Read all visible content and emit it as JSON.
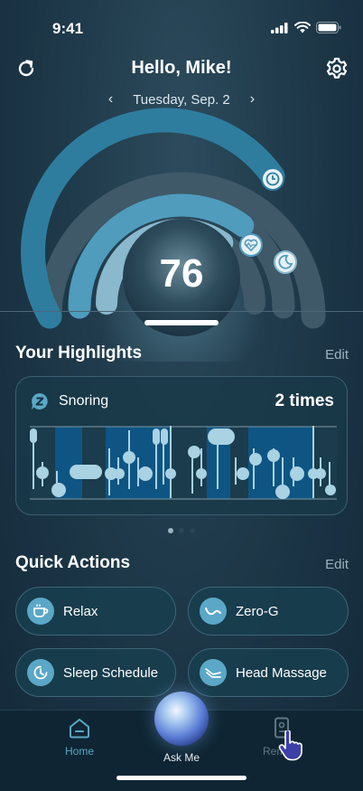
{
  "status": {
    "time": "9:41"
  },
  "header": {
    "greeting": "Hello, Mike!",
    "date": "Tuesday, Sep. 2"
  },
  "score": {
    "value": "76"
  },
  "highlights": {
    "title": "Your Highlights",
    "edit_label": "Edit",
    "card": {
      "label": "Snoring",
      "count": "2 times"
    },
    "page_count": 3,
    "current_page": 1
  },
  "quick_actions": {
    "title": "Quick Actions",
    "edit_label": "Edit",
    "items": [
      {
        "label": "Relax",
        "icon": "cup-icon"
      },
      {
        "label": "Zero-G",
        "icon": "zero-g-icon"
      },
      {
        "label": "Sleep Schedule",
        "icon": "clock-icon"
      },
      {
        "label": "Head Massage",
        "icon": "massage-icon"
      }
    ]
  },
  "tabbar": {
    "home_label": "Home",
    "ask_label": "Ask Me",
    "remote_label": "Remote"
  },
  "colors": {
    "accent": "#5aa7c7",
    "ring_outer": "#2e7d9e",
    "ring_middle": "#4f9cbd",
    "ring_inner": "#8ab8cc",
    "ring_track": "#3f5968"
  }
}
